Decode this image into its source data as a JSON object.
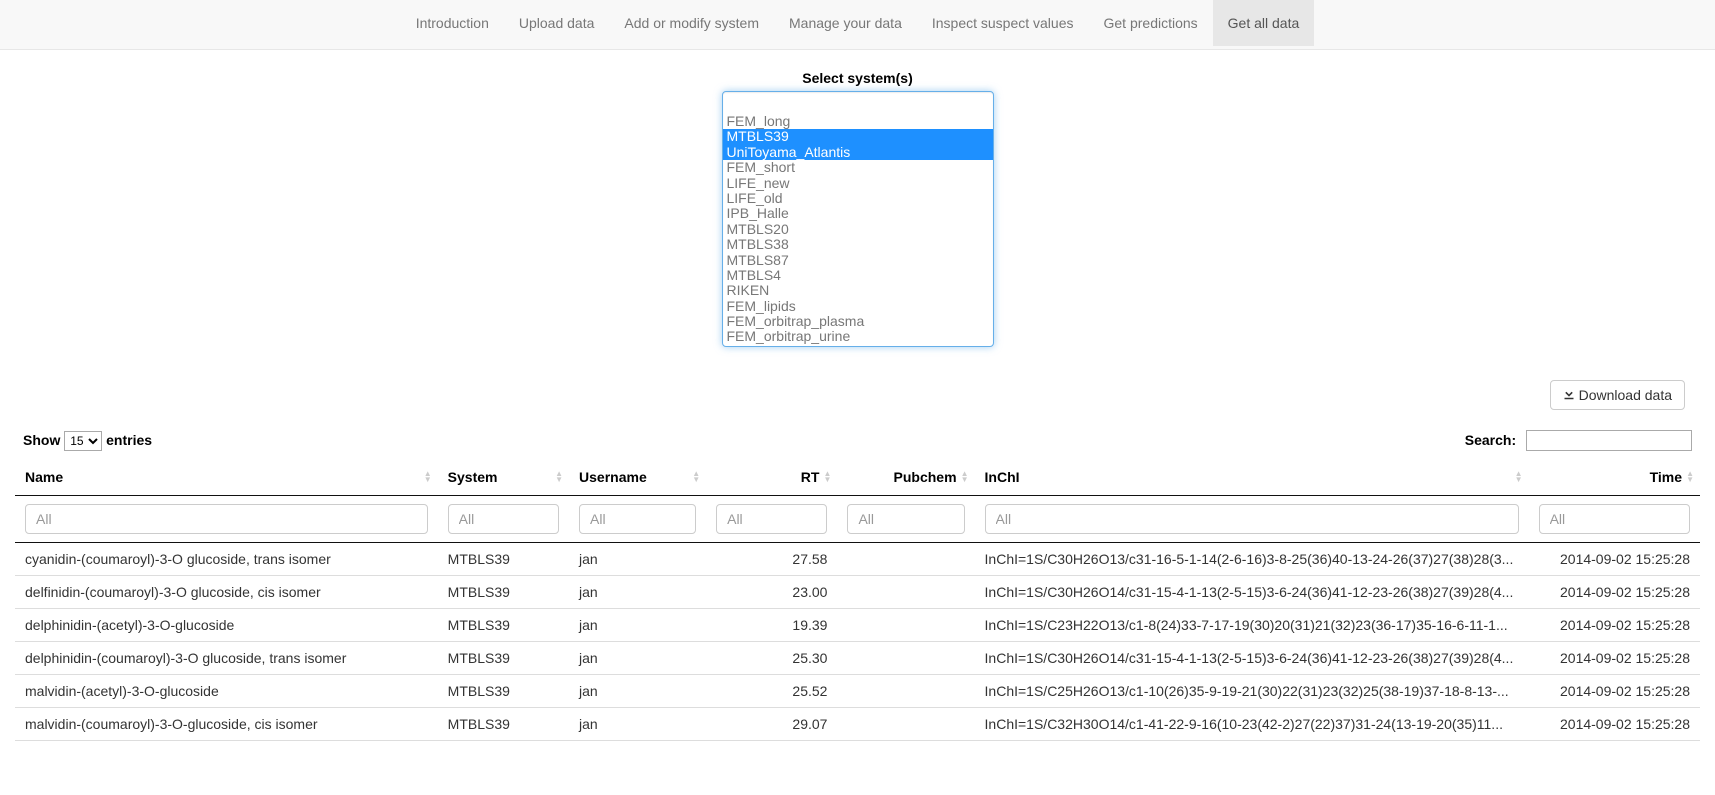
{
  "nav": {
    "tabs": [
      {
        "label": "Introduction"
      },
      {
        "label": "Upload data"
      },
      {
        "label": "Add or modify system"
      },
      {
        "label": "Manage your data"
      },
      {
        "label": "Inspect suspect values"
      },
      {
        "label": "Get predictions"
      },
      {
        "label": "Get all data"
      }
    ],
    "active_index": 6
  },
  "select_systems": {
    "label": "Select system(s)",
    "options": [
      {
        "label": "FEM_long",
        "selected": false
      },
      {
        "label": "MTBLS39",
        "selected": true
      },
      {
        "label": "UniToyama_Atlantis",
        "selected": true
      },
      {
        "label": "FEM_short",
        "selected": false
      },
      {
        "label": "LIFE_new",
        "selected": false
      },
      {
        "label": "LIFE_old",
        "selected": false
      },
      {
        "label": "IPB_Halle",
        "selected": false
      },
      {
        "label": "MTBLS20",
        "selected": false
      },
      {
        "label": "MTBLS38",
        "selected": false
      },
      {
        "label": "MTBLS87",
        "selected": false
      },
      {
        "label": "MTBLS4",
        "selected": false
      },
      {
        "label": "RIKEN",
        "selected": false
      },
      {
        "label": "FEM_lipids",
        "selected": false
      },
      {
        "label": "FEM_orbitrap_plasma",
        "selected": false
      },
      {
        "label": "FEM_orbitrap_urine",
        "selected": false
      }
    ]
  },
  "download": {
    "label": "Download data"
  },
  "datatable": {
    "length": {
      "prefix": "Show",
      "value": "15",
      "suffix": "entries"
    },
    "search": {
      "label": "Search:",
      "value": ""
    },
    "columns": [
      {
        "title": "Name",
        "align": "left",
        "filter_placeholder": "All"
      },
      {
        "title": "System",
        "align": "left",
        "filter_placeholder": "All"
      },
      {
        "title": "Username",
        "align": "left",
        "filter_placeholder": "All"
      },
      {
        "title": "RT",
        "align": "right",
        "filter_placeholder": "All"
      },
      {
        "title": "Pubchem",
        "align": "right",
        "filter_placeholder": "All"
      },
      {
        "title": "InChI",
        "align": "left",
        "filter_placeholder": "All"
      },
      {
        "title": "Time",
        "align": "right",
        "filter_placeholder": "All"
      }
    ],
    "rows": [
      {
        "name": "cyanidin-(coumaroyl)-3-O glucoside, trans isomer",
        "system": "MTBLS39",
        "username": "jan",
        "rt": "27.58",
        "pubchem": "",
        "inchi": "InChI=1S/C30H26O13/c31-16-5-1-14(2-6-16)3-8-25(36)40-13-24-26(37)27(38)28(3...",
        "time": "2014-09-02 15:25:28"
      },
      {
        "name": "delfinidin-(coumaroyl)-3-O glucoside, cis isomer",
        "system": "MTBLS39",
        "username": "jan",
        "rt": "23.00",
        "pubchem": "",
        "inchi": "InChI=1S/C30H26O14/c31-15-4-1-13(2-5-15)3-6-24(36)41-12-23-26(38)27(39)28(4...",
        "time": "2014-09-02 15:25:28"
      },
      {
        "name": "delphinidin-(acetyl)-3-O-glucoside",
        "system": "MTBLS39",
        "username": "jan",
        "rt": "19.39",
        "pubchem": "",
        "inchi": "InChI=1S/C23H22O13/c1-8(24)33-7-17-19(30)20(31)21(32)23(36-17)35-16-6-11-1...",
        "time": "2014-09-02 15:25:28"
      },
      {
        "name": "delphinidin-(coumaroyl)-3-O glucoside, trans isomer",
        "system": "MTBLS39",
        "username": "jan",
        "rt": "25.30",
        "pubchem": "",
        "inchi": "InChI=1S/C30H26O14/c31-15-4-1-13(2-5-15)3-6-24(36)41-12-23-26(38)27(39)28(4...",
        "time": "2014-09-02 15:25:28"
      },
      {
        "name": "malvidin-(acetyl)-3-O-glucoside",
        "system": "MTBLS39",
        "username": "jan",
        "rt": "25.52",
        "pubchem": "",
        "inchi": "InChI=1S/C25H26O13/c1-10(26)35-9-19-21(30)22(31)23(32)25(38-19)37-18-8-13-...",
        "time": "2014-09-02 15:25:28"
      },
      {
        "name": "malvidin-(coumaroyl)-3-O-glucoside, cis isomer",
        "system": "MTBLS39",
        "username": "jan",
        "rt": "29.07",
        "pubchem": "",
        "inchi": "InChI=1S/C32H30O14/c1-41-22-9-16(10-23(42-2)27(22)37)31-24(13-19-20(35)11...",
        "time": "2014-09-02 15:25:28"
      }
    ]
  }
}
